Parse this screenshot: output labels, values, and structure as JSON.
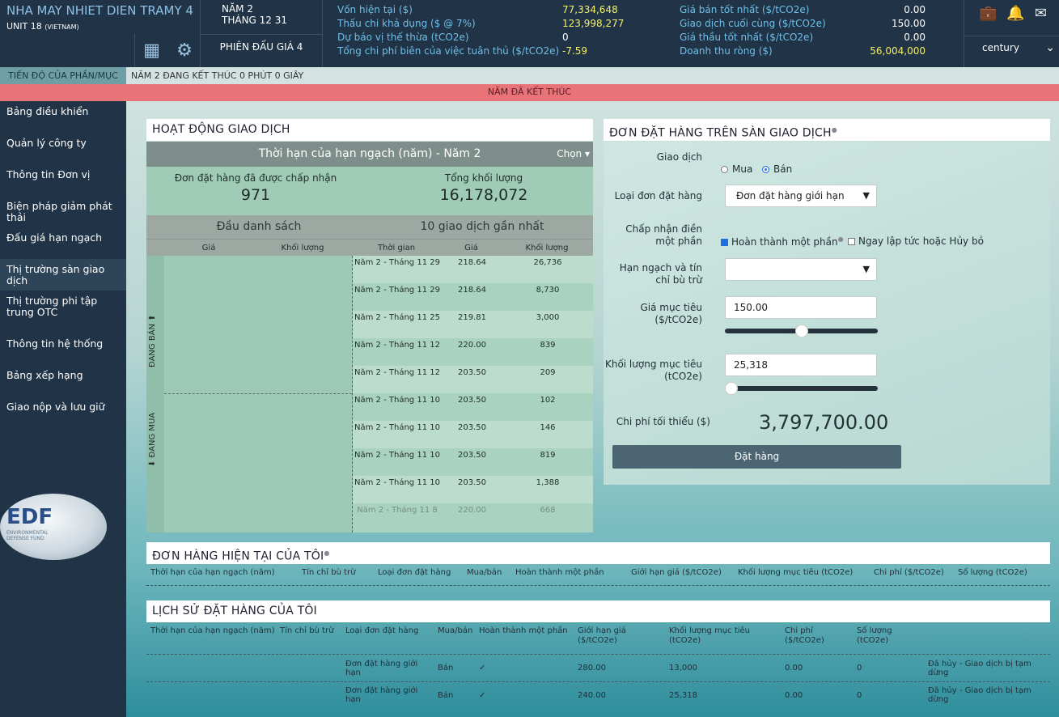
{
  "header": {
    "plant_name": "NHA MAY NHIET DIEN TRAMY 4",
    "unit": "UNIT 18",
    "unit_country": "(VIETNAM)",
    "period_year": "NĂM 2",
    "period_month": "THÁNG 12 31",
    "session": "PHIÊN ĐẤU GIÁ 4",
    "stats_left": [
      {
        "label": "Vốn hiện tại ($)",
        "value": "77,334,648"
      },
      {
        "label": "Thấu chi khả dụng ($ @ 7%)",
        "value": "123,998,277"
      },
      {
        "label": "Dự báo vị thế thừa (tCO2e)",
        "value": "0"
      },
      {
        "label": "Tổng chi phí biên của việc tuân thủ ($/tCO2e)",
        "value": "-7.59"
      }
    ],
    "stats_right": [
      {
        "label": "Giá bán tốt nhất ($/tCO2e)",
        "value": "0.00"
      },
      {
        "label": "Giao dịch cuối cùng ($/tCO2e)",
        "value": "150.00"
      },
      {
        "label": "Giá thầu tốt nhất ($/tCO2e)",
        "value": "0.00"
      },
      {
        "label": "Doanh thu ròng ($)",
        "value": "56,004,000"
      }
    ],
    "user": "century"
  },
  "strip": {
    "label": "TIẾN ĐỘ CỦA PHẦN/MỤC",
    "text": "NĂM 2 ĐANG KẾT THÚC 0 PHÚT 0 GIÂY"
  },
  "banner": "NĂM ĐÃ KẾT THÚC",
  "sidebar": {
    "items": [
      {
        "label": "Bảng điều khiển"
      },
      {
        "label": "Quản lý công ty"
      },
      {
        "label": "Thông tin Đơn vị"
      },
      {
        "label": "Biện pháp giảm phát thải"
      },
      {
        "label": "Đấu giá hạn ngạch"
      },
      {
        "label": "Thị trường sàn giao dịch"
      },
      {
        "label": "Thị trường phi tập trung OTC"
      },
      {
        "label": "Thông tin hệ thống"
      },
      {
        "label": "Bảng xếp hạng"
      },
      {
        "label": "Giao nộp và lưu giữ"
      }
    ],
    "logo_text": "EDF",
    "logo_sub": "ENVIRONMENTAL DEFENSE FUND"
  },
  "trading": {
    "title": "HOẠT ĐỘNG GIAO DỊCH",
    "head": "Thời hạn của hạn ngạch (năm) - Năm 2",
    "pick": "Chọn ▾",
    "accepted_label": "Đơn đặt hàng đã được chấp nhận",
    "accepted_value": "971",
    "volume_label": "Tổng khối lượng",
    "volume_value": "16,178,072",
    "book_title": "Đầu danh sách",
    "recent_title": "10 giao dịch gần nhất",
    "cols": [
      "Giá",
      "Khối lượng",
      "Thời gian",
      "Giá",
      "Khối lượng"
    ],
    "selling": "ĐANG BÁN ⬆",
    "buying": "⬇ ĐANG MUA",
    "trades": [
      {
        "time": "Năm 2 - Tháng 11 29",
        "price": "218.64",
        "qty": "26,736"
      },
      {
        "time": "Năm 2 - Tháng 11 29",
        "price": "218.64",
        "qty": "8,730"
      },
      {
        "time": "Năm 2 - Tháng 11 25",
        "price": "219.81",
        "qty": "3,000"
      },
      {
        "time": "Năm 2 - Tháng 11 12",
        "price": "220.00",
        "qty": "839"
      },
      {
        "time": "Năm 2 - Tháng 11 12",
        "price": "203.50",
        "qty": "209"
      },
      {
        "time": "Năm 2 - Tháng 11 10",
        "price": "203.50",
        "qty": "102"
      },
      {
        "time": "Năm 2 - Tháng 11 10",
        "price": "203.50",
        "qty": "146"
      },
      {
        "time": "Năm 2 - Tháng 11 10",
        "price": "203.50",
        "qty": "819"
      },
      {
        "time": "Năm 2 - Tháng 11 10",
        "price": "203.50",
        "qty": "1,388"
      },
      {
        "time": "Năm 2 - Tháng 11 8",
        "price": "220.00",
        "qty": "668"
      }
    ]
  },
  "order_form": {
    "title": "ĐƠN ĐẶT HÀNG TRÊN SÀN GIAO DỊCH",
    "trade_label": "Giao dịch",
    "buy": "Mua",
    "sell": "Bán",
    "type_label": "Loại đơn đặt hàng",
    "type_value": "Đơn đặt hàng giới hạn",
    "partial_label": "Chấp nhận điền một phần",
    "partial_opt": "Hoàn thành một phần",
    "ioc_opt": "Ngay lập tức hoặc Hủy bỏ",
    "quota_label": "Hạn ngạch và tín chỉ bù trừ",
    "quota_value": "",
    "price_label": "Giá mục tiêu ($/tCO2e)",
    "price_value": "150.00",
    "volume_label": "Khối lượng mục tiêu (tCO2e)",
    "volume_value": "25,318",
    "min_cost_label": "Chi phí tối thiểu ($)",
    "min_cost_value": "3,797,700.00",
    "submit": "Đặt hàng"
  },
  "current_orders": {
    "title": "ĐƠN HÀNG HIỆN TẠI CỦA TÔI",
    "cols": [
      "Thời hạn của hạn ngạch (năm)",
      "Tín chỉ bù trừ",
      "Loại đơn đặt hàng",
      "Mua/bán",
      "Hoàn thành một phần",
      "Giới hạn giá ($/tCO2e)",
      "Khối lượng mục tiêu (tCO2e)",
      "Chi phí ($/tCO2e)",
      "Số lượng (tCO2e)"
    ]
  },
  "history": {
    "title": "LỊCH SỬ ĐẶT HÀNG CỦA TÔI",
    "cols": [
      "Thời hạn của hạn ngạch (năm)",
      "Tín chỉ bù trừ",
      "Loại đơn đặt hàng",
      "Mua/bán",
      "Hoàn thành một phần",
      "Giới hạn giá ($/tCO2e)",
      "Khối lượng mục tiêu (tCO2e)",
      "Chi phí ($/tCO2e)",
      "Số lượng (tCO2e)",
      ""
    ],
    "rows": [
      {
        "type": "Đơn đặt hàng giới hạn",
        "side": "Bán",
        "partial": "✓",
        "price": "280.00",
        "volume": "13,000",
        "cost": "0.00",
        "qty": "0",
        "status": "Đã hủy - Giao dịch bị tạm dừng"
      },
      {
        "type": "Đơn đặt hàng giới hạn",
        "side": "Bán",
        "partial": "✓",
        "price": "240.00",
        "volume": "25,318",
        "cost": "0.00",
        "qty": "0",
        "status": "Đã hủy - Giao dịch bị tạm dừng"
      }
    ]
  },
  "colors": {
    "header_bg": "#213447",
    "banner": "#e8747a",
    "accent": "#6fbfe8",
    "highlight": "#f3f06a"
  },
  "slider_levels": {
    "price_fraction": 0.5,
    "volume_fraction": 0.0
  }
}
